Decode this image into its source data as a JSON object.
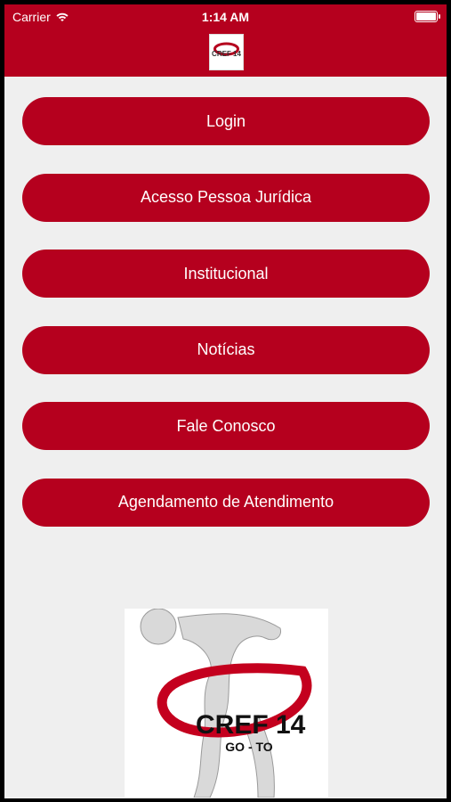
{
  "status_bar": {
    "carrier": "Carrier",
    "time": "1:14 AM"
  },
  "menu": [
    {
      "label": "Login"
    },
    {
      "label": "Acesso Pessoa Jurídica"
    },
    {
      "label": "Institucional"
    },
    {
      "label": "Notícias"
    },
    {
      "label": "Fale Conosco"
    },
    {
      "label": "Agendamento de Atendimento"
    }
  ],
  "logo": {
    "title": "CREF 14",
    "subtitle": "GO - TO"
  },
  "colors": {
    "primary": "#b5001e",
    "background": "#efefef"
  }
}
